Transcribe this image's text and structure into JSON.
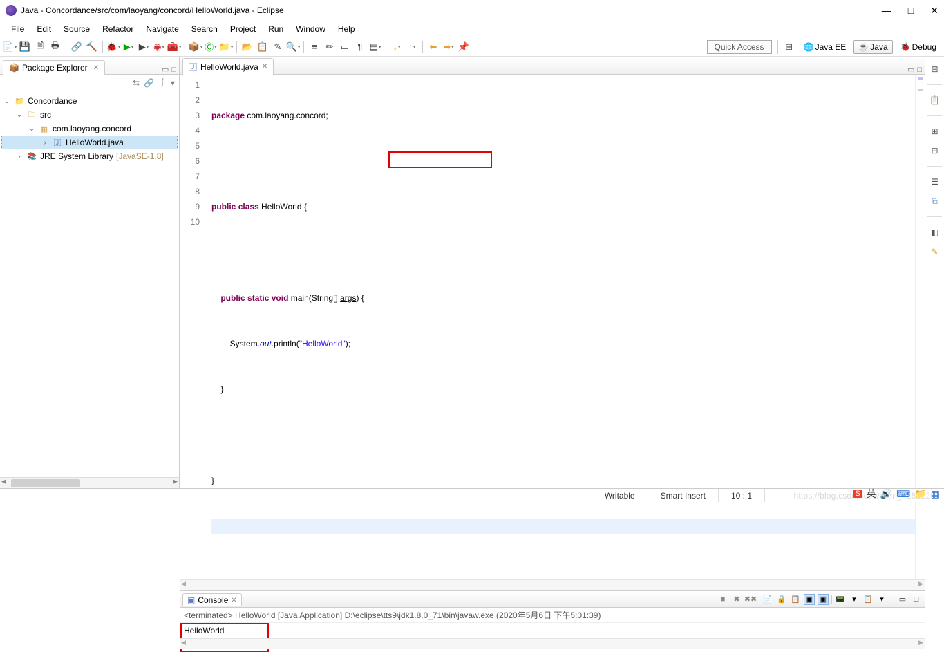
{
  "window": {
    "title": "Java - Concordance/src/com/laoyang/concord/HelloWorld.java - Eclipse"
  },
  "menu": [
    "File",
    "Edit",
    "Source",
    "Refactor",
    "Navigate",
    "Search",
    "Project",
    "Run",
    "Window",
    "Help"
  ],
  "quick_access": "Quick Access",
  "perspectives": {
    "java_ee": "Java EE",
    "java": "Java",
    "debug": "Debug"
  },
  "package_explorer": {
    "title": "Package Explorer",
    "tree": {
      "project": "Concordance",
      "src": "src",
      "pkg": "com.laoyang.concord",
      "file": "HelloWorld.java",
      "jre": "JRE System Library",
      "jre_decor": "[JavaSE-1.8]"
    }
  },
  "editor": {
    "tab": "HelloWorld.java",
    "lines": [
      "1",
      "2",
      "3",
      "4",
      "5",
      "6",
      "7",
      "8",
      "9",
      "10"
    ],
    "code": {
      "l1_kw": "package",
      "l1_rest": " com.laoyang.concord;",
      "l3_kw1": "public",
      "l3_kw2": "class",
      "l3_rest": " HelloWorld {",
      "l5_pre": "    ",
      "l5_kw1": "public",
      "l5_kw2": "static",
      "l5_kw3": "void",
      "l5_rest1": " main(String[] ",
      "l5_arg": "args",
      "l5_rest2": ") {",
      "l6_pre": "        System.",
      "l6_out": "out",
      "l6_mid": ".println(",
      "l6_str": "\"HelloWorld\"",
      "l6_end": ");",
      "l7": "    }",
      "l9": "}"
    }
  },
  "console": {
    "title": "Console",
    "info": "<terminated> HelloWorld [Java Application] D:\\eclipse\\tts9\\jdk1.8.0_71\\bin\\javaw.exe (2020年5月6日 下午5:01:39)",
    "output": "HelloWorld"
  },
  "status": {
    "writable": "Writable",
    "insert": "Smart Insert",
    "pos": "10 : 1"
  },
  "watermark": "https://blog.csdn.net/weixin_41882200",
  "tray": {
    "ime": "英"
  }
}
